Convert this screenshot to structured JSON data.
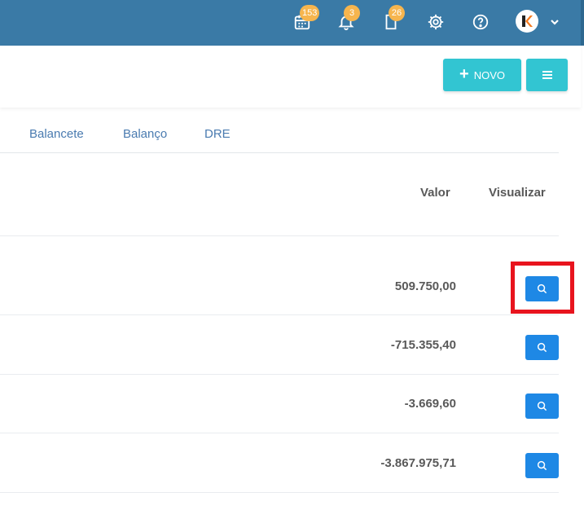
{
  "topbar": {
    "calendar_badge": "153",
    "notifications_badge": "3",
    "documents_badge": "26",
    "bg_color": "#3a7aa6",
    "badge_color": "#f6b54e"
  },
  "actions": {
    "novo_label": "NOVO",
    "accent_color": "#32c5d2"
  },
  "tabs": [
    {
      "label": "Balancete"
    },
    {
      "label": "Balanço"
    },
    {
      "label": "DRE"
    }
  ],
  "table": {
    "headers": {
      "valor": "Valor",
      "visualizar": "Visualizar"
    },
    "rows": [
      {
        "valor": "509.750,00"
      },
      {
        "valor": "-715.355,40"
      },
      {
        "valor": "-3.669,60"
      },
      {
        "valor": "-3.867.975,71"
      }
    ],
    "button_color": "#1e88e5",
    "highlight_color": "#e8141e"
  }
}
